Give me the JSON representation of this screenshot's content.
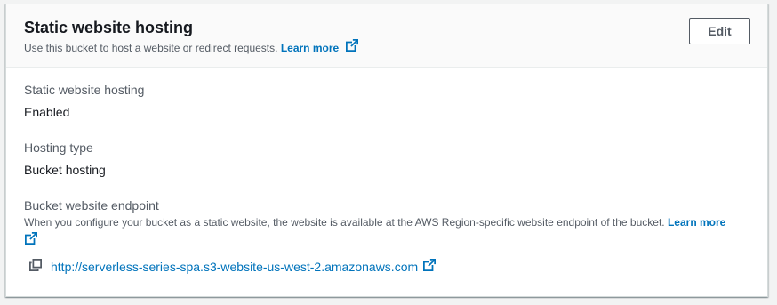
{
  "panel": {
    "title": "Static website hosting",
    "description": "Use this bucket to host a website or redirect requests.",
    "learn_more": "Learn more",
    "edit_label": "Edit"
  },
  "fields": {
    "hosting": {
      "label": "Static website hosting",
      "value": "Enabled"
    },
    "hosting_type": {
      "label": "Hosting type",
      "value": "Bucket hosting"
    },
    "endpoint": {
      "label": "Bucket website endpoint",
      "description": "When you configure your bucket as a static website, the website is available at the AWS Region-specific website endpoint of the bucket.",
      "learn_more": "Learn more",
      "url": "http://serverless-series-spa.s3-website-us-west-2.amazonaws.com"
    }
  },
  "icons": {
    "external_link": "external-link-icon",
    "copy": "copy-icon"
  },
  "colors": {
    "link": "#0073bb",
    "text_primary": "#16191f",
    "text_secondary": "#545b64",
    "background": "#f2f3f3"
  }
}
